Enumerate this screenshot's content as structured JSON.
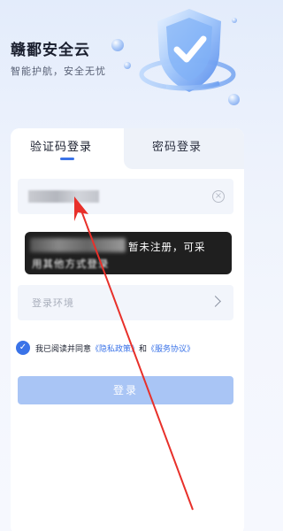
{
  "header": {
    "title": "赣鄱安全云",
    "subtitle": "智能护航，安全无忧"
  },
  "tabs": [
    {
      "label": "验证码登录",
      "active": true
    },
    {
      "label": "密码登录",
      "active": false
    }
  ],
  "form": {
    "phone_value_masked": true,
    "clear_icon": "clear-icon",
    "environment_placeholder": "登录环境",
    "environment_icon": "chevron-right-icon"
  },
  "agreement": {
    "checked": true,
    "prefix": "我已阅读并同意",
    "privacy_link": "《隐私政策》",
    "and": "和",
    "service_link": "《服务协议》"
  },
  "login_button": {
    "label": "登录"
  },
  "toast": {
    "line1": "暂未注册，可采",
    "line2": "用其他方式登录"
  },
  "colors": {
    "accent": "#3a73e8",
    "button_disabled": "#a9c5f5",
    "annotation_arrow": "#e8302a"
  }
}
